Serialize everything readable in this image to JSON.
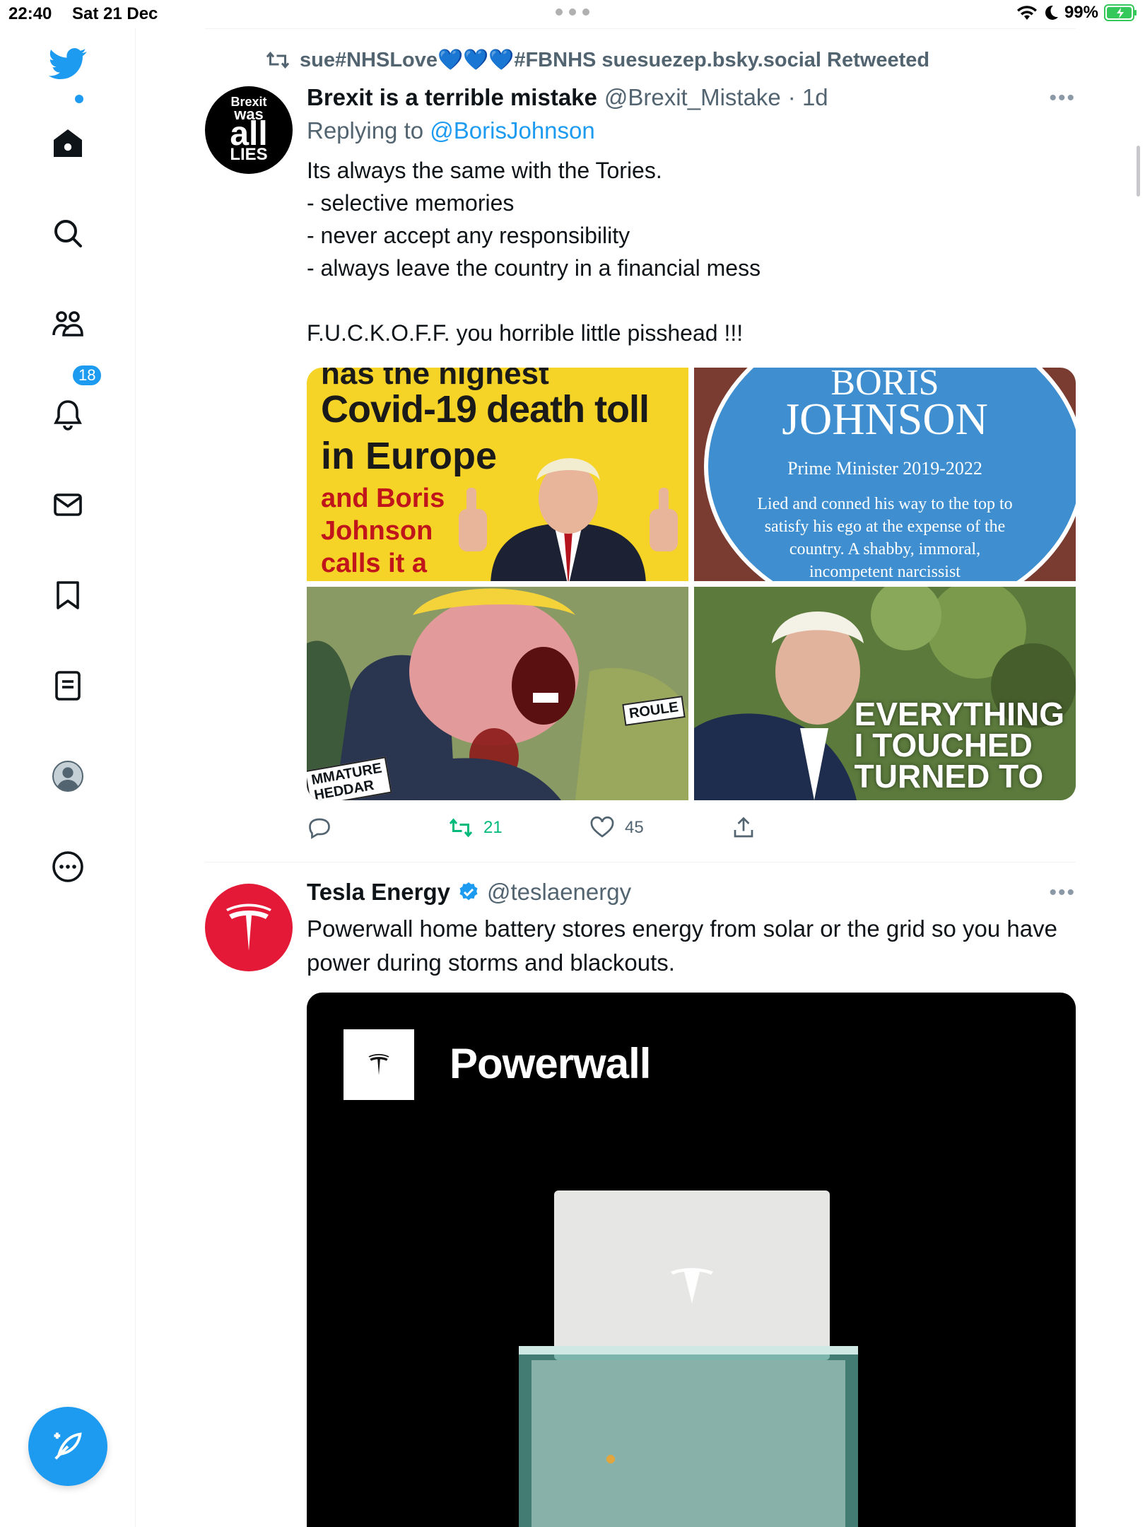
{
  "status_bar": {
    "time": "22:40",
    "date": "Sat 21 Dec",
    "battery": "99%"
  },
  "sidebar": {
    "notifications_count": "18"
  },
  "tweet1": {
    "retweeted_by": "sue#NHSLove💙💙💙#FBNHS suesuezep.bsky.social Retweeted",
    "name": "Brexit is a terrible mistake",
    "handle": "@Brexit_Mistake",
    "time": "· 1d",
    "replying_prefix": "Replying to",
    "replying_to": "@BorisJohnson",
    "text": "Its always the same with the Tories.\n- selective memories\n- never accept any responsibility\n- always leave the country in a financial mess\n\nF.U.C.K.O.F.F. you horrible little pisshead !!!",
    "avatar_text": [
      "Brexit",
      "was",
      "all",
      "LIES"
    ],
    "media": {
      "m1": {
        "l1": "has the highest",
        "l2": "Covid-19 death toll",
        "l3": "in Europe",
        "l4": "and Boris",
        "l5": "Johnson",
        "l6": "calls it a"
      },
      "m2": {
        "l1": "BORIS",
        "l2": "JOHNSON",
        "l3": "Prime Minister 2019-2022",
        "l4": "Lied and conned his way to the top to",
        "l5": "satisfy his ego at the expense of the",
        "l6": "country. A shabby, immoral,",
        "l7": "incompetent narcissist"
      },
      "m3": {
        "l1": "ROULE",
        "l2": "MMATURE",
        "l3": "HEDDAR"
      },
      "m4": {
        "l1": "EVERYTHING",
        "l2": "I TOUCHED",
        "l3": "TURNED TO"
      }
    },
    "retweets": "21",
    "likes": "45"
  },
  "tweet2": {
    "name": "Tesla Energy",
    "handle": "@teslaenergy",
    "text": "Powerwall home battery stores energy from solar or the grid so you have power during storms and blackouts.",
    "card_title": "Powerwall"
  },
  "colors": {
    "accent": "#1d9bf0",
    "retweet_green": "#00ba7c",
    "tesla_red": "#e31937"
  }
}
